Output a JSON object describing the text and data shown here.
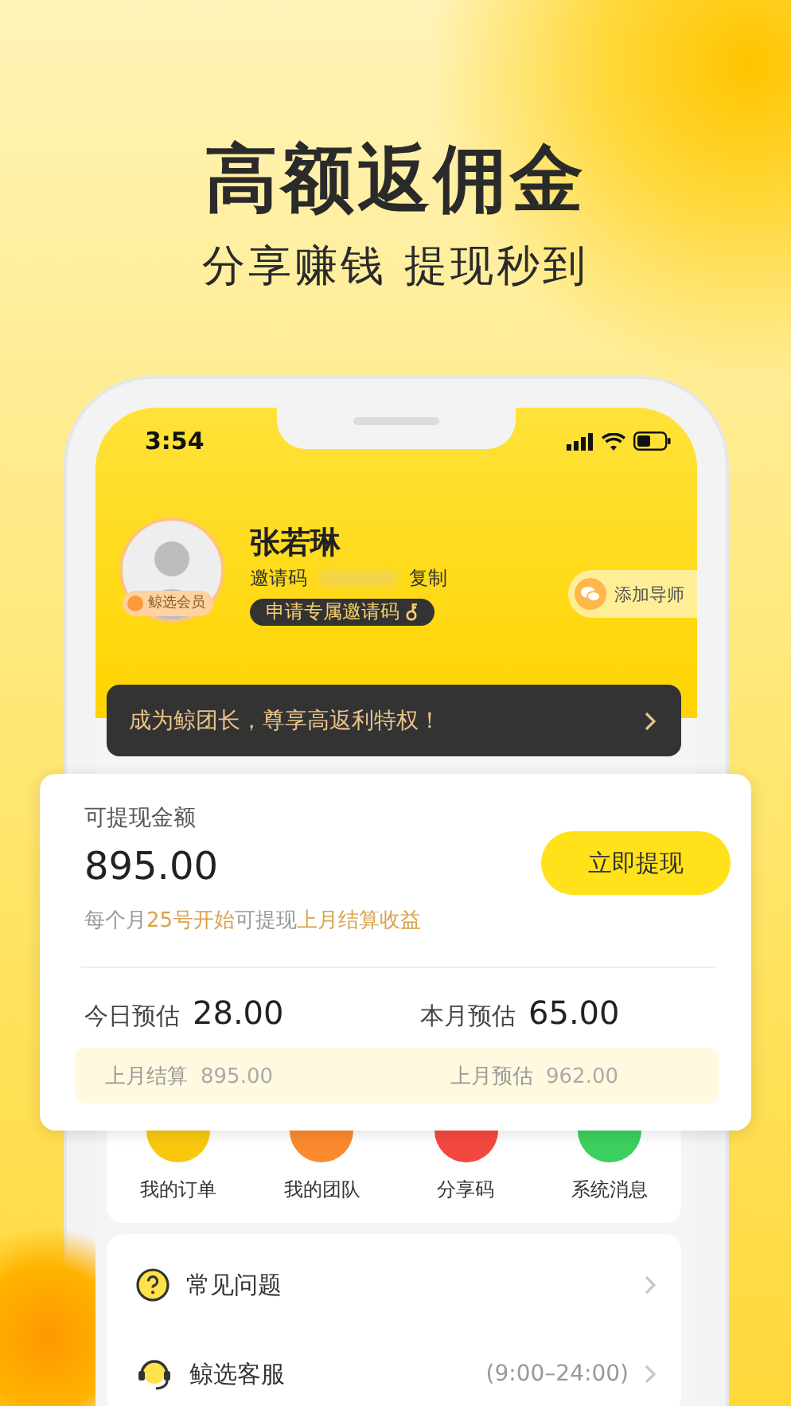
{
  "promo": {
    "headline": "高额返佣金",
    "subtitle": "分享赚钱 提现秒到"
  },
  "status_bar": {
    "time": "3:54"
  },
  "profile": {
    "name": "张若琳",
    "badge": "鲸选会员",
    "invite_label": "邀请码",
    "copy": "复制",
    "apply_button": "申请专属邀请码",
    "mentor_button": "添加导师"
  },
  "banner": {
    "text": "成为鲸团长，尊享高返利特权！"
  },
  "balance": {
    "label": "可提现金额",
    "amount": "895.00",
    "button": "立即提现",
    "note": [
      {
        "text": "每个月",
        "highlight": false
      },
      {
        "text": "25号开始",
        "highlight": true
      },
      {
        "text": "可提现",
        "highlight": false
      },
      {
        "text": "上月结算收益",
        "highlight": true
      }
    ],
    "estimates": [
      {
        "label": "今日预估",
        "value": "28.00"
      },
      {
        "label": "本月预估",
        "value": "65.00"
      }
    ],
    "settled": [
      {
        "label": "上月结算",
        "value": "895.00"
      },
      {
        "label": "上月预估",
        "value": "962.00"
      }
    ]
  },
  "quick_actions": [
    {
      "label": "我的订单",
      "color": "#f9c80e"
    },
    {
      "label": "我的团队",
      "color": "#fb8a2e"
    },
    {
      "label": "分享码",
      "color": "#f4473f"
    },
    {
      "label": "系统消息",
      "color": "#3ccf5e"
    }
  ],
  "menu": [
    {
      "kind": "faq",
      "label": "常见问题"
    },
    {
      "kind": "service",
      "label": "鲸选客服",
      "note": "(9:00–24:00)"
    }
  ]
}
